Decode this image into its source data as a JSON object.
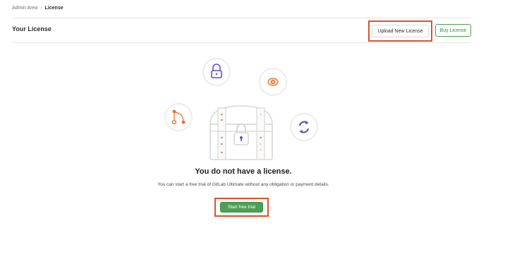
{
  "breadcrumb": {
    "parent": "Admin Area",
    "separator": "›",
    "current": "License"
  },
  "header": {
    "title": "Your License",
    "upload_label": "Upload New License",
    "buy_label": "Buy License"
  },
  "empty_state": {
    "title": "You do not have a license.",
    "description": "You can start a free trial of GitLab Ultimate without any obligation or payment details.",
    "trial_label": "Start free trial"
  },
  "illustration": {
    "icons": [
      "lock-icon",
      "eye-icon",
      "merge-icon",
      "refresh-icon",
      "treasure-chest-icon"
    ]
  },
  "colors": {
    "highlight_border": "#d9542b",
    "primary_green": "#4e9f54",
    "accent_orange": "#e8702a",
    "accent_purple": "#6b4fbb"
  }
}
